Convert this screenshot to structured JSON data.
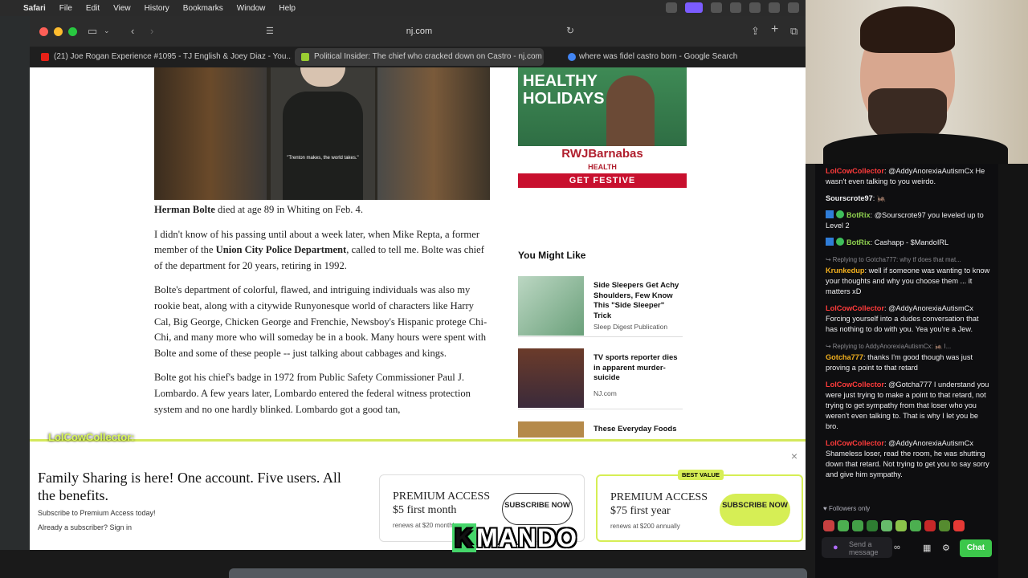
{
  "menubar": {
    "app": "Safari",
    "items": [
      "File",
      "Edit",
      "View",
      "History",
      "Bookmarks",
      "Window",
      "Help"
    ]
  },
  "safari": {
    "url": "nj.com",
    "tabs": [
      {
        "label": "(21) Joe Rogan Experience #1095 - TJ English & Joey Diaz - You..."
      },
      {
        "label": "Political Insider: The chief who cracked down on Castro - nj.com"
      },
      {
        "label": "where was fidel castro born - Google Search"
      }
    ]
  },
  "article": {
    "video_quote": "\"Trenton makes, the world takes.\"",
    "caption_name": "Herman Bolte",
    "caption_rest": " died at age 89 in Whiting on Feb. 4.",
    "p1_a": "I didn't know of his passing until about a week later, when Mike Repta, a former member of the ",
    "p1_b": "Union City Police Department",
    "p1_c": ", called to tell me. Bolte was chief of the department for 20 years, retiring in 1992.",
    "p2": "Bolte's department of colorful, flawed, and intriguing individuals was also my rookie beat, along with a citywide Runyonesque world of characters like Harry Cal, Big George, Chicken George and Frenchie, Newsboy's Hispanic protege Chi-Chi, and many more who will someday be in a book. Many hours were spent with Bolte and some of these people -- just talking about cabbages and kings.",
    "p3": "Bolte got his chief's badge in 1972 from Public Safety Commissioner Paul J. Lombardo. A few years later, Lombardo entered the federal witness protection system and no one hardly blinked. Lombardo got a good tan,"
  },
  "ad": {
    "headline_1": "HEALTHY",
    "headline_2": "HOLIDAYS",
    "brand": "RWJBarnabas",
    "brand_sub": "HEALTH",
    "cta": "GET FESTIVE"
  },
  "you_might_like": {
    "title": "You Might Like",
    "items": [
      {
        "title": "Side Sleepers Get Achy Shoulders, Few Know This \"Side Sleeper\" Trick",
        "source": "Sleep Digest Publication"
      },
      {
        "title": "TV sports reporter dies in apparent murder-suicide",
        "source": "NJ.com"
      },
      {
        "title": "These Everyday Foods",
        "source": ""
      }
    ]
  },
  "premium": {
    "headline": "Family Sharing is here! One account. Five users. All the benefits.",
    "subscribe_text": "Subscribe to Premium Access today!",
    "already": "Already a subscriber? Sign in",
    "plans": [
      {
        "name_1": "PREMIUM ACCESS",
        "name_2": "$5 first month",
        "renew": "renews at $20 monthly",
        "button": "SUBSCRIBE NOW",
        "badge": ""
      },
      {
        "name_1": "PREMIUM ACCESS",
        "name_2": "$75 first year",
        "renew": "renews at $200 annually",
        "button": "SUBSCRIBE NOW",
        "badge": "BEST VALUE"
      }
    ],
    "close": "×"
  },
  "stream_overlay": {
    "chat_user": "LolCowCollector:",
    "logo_k": "K",
    "logo_rest": "MANDO"
  },
  "chat": {
    "messages": [
      {
        "reply": "",
        "user": "LolCowCollector",
        "color": "#ff3b3b",
        "text": ": @AddyAnorexiaAutismCx He wasn't even talking to you weirdo.",
        "badges": false
      },
      {
        "reply": "",
        "user": "Sourscrote97",
        "color": "#efeff1",
        "text": ": 🦗",
        "badges": false
      },
      {
        "reply": "",
        "user": "BotRix",
        "color": "#8fd14f",
        "text": ": @Sourscrote97 you leveled up to Level 2",
        "badges": true
      },
      {
        "reply": "",
        "user": "BotRix",
        "color": "#8fd14f",
        "text": ": Cashapp - $MandoIRL",
        "badges": true
      },
      {
        "reply": "↪ Replying to Gotcha777: why tf does that mat...",
        "user": "Krunkedup",
        "color": "#f2b01e",
        "text": ": well if someone was wanting to know your thoughts and why you choose them ... it matters xD",
        "badges": false
      },
      {
        "reply": "",
        "user": "LolCowCollector",
        "color": "#ff3b3b",
        "text": ": @AddyAnorexiaAutismCx Forcing yourself into a dudes conversation that has nothing to do with you. Yea you're a Jew.",
        "badges": false
      },
      {
        "reply": "↪ Replying to AddyAnorexiaAutismCx: 🦗 I...",
        "user": "Gotcha777",
        "color": "#f2b01e",
        "text": ": thanks I'm good though was just proving a point to that retard",
        "badges": false
      },
      {
        "reply": "",
        "user": "LolCowCollector",
        "color": "#ff3b3b",
        "text": ": @Gotcha777 I understand you were just trying to make a point to that retard, not trying to get sympathy from that loser who you weren't even talking to. That is why I let you be bro.",
        "badges": false
      },
      {
        "reply": "",
        "user": "LolCowCollector",
        "color": "#ff3b3b",
        "text": ": @AddyAnorexiaAutismCx Shameless loser, read the room, he was shutting down that retard. Not trying to get you to say sorry and give him sympathy.",
        "badges": false
      }
    ],
    "followers_only": "♥ Followers only",
    "input_placeholder": "Send a message",
    "chat_button": "Chat"
  }
}
